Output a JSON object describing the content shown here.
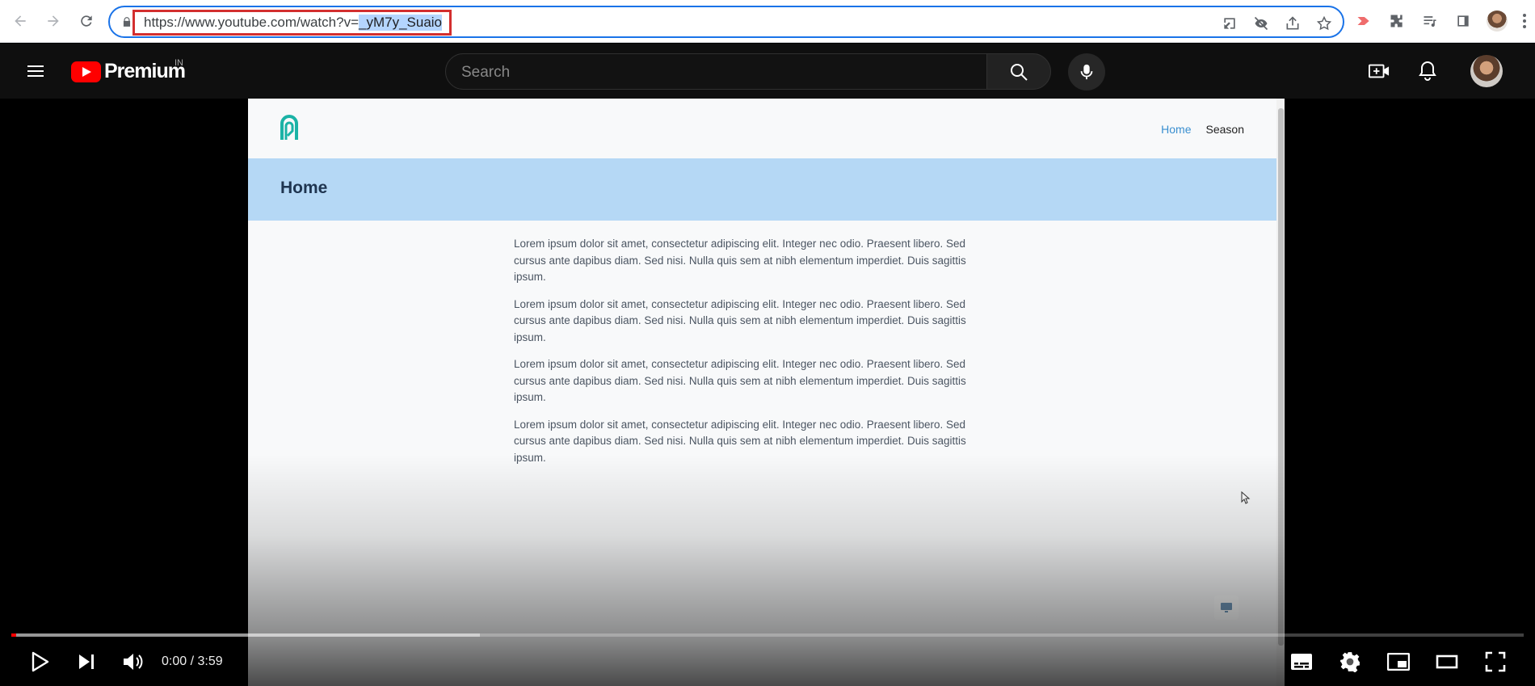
{
  "browser": {
    "url_prefix": "https://www.youtube.com/watch?v=",
    "url_selected": "_yM7y_Suaio",
    "icons": [
      "back-icon",
      "forward-icon",
      "reload-icon",
      "lock-icon",
      "install-icon",
      "eye-off-icon",
      "share-icon",
      "star-icon",
      "extension-icon",
      "puzzle-icon",
      "media-icon",
      "sidepanel-icon",
      "profile-avatar",
      "menu-icon"
    ]
  },
  "youtube": {
    "logo_text": "Premium",
    "country_code": "IN",
    "search_placeholder": "Search"
  },
  "video": {
    "site": {
      "nav_links": [
        "Home",
        "Season"
      ],
      "page_heading": "Home",
      "paragraphs": [
        "Lorem ipsum dolor sit amet, consectetur adipiscing elit. Integer nec odio. Praesent libero. Sed cursus ante dapibus diam. Sed nisi. Nulla quis sem at nibh elementum imperdiet. Duis sagittis ipsum.",
        "Lorem ipsum dolor sit amet, consectetur adipiscing elit. Integer nec odio. Praesent libero. Sed cursus ante dapibus diam. Sed nisi. Nulla quis sem at nibh elementum imperdiet. Duis sagittis ipsum.",
        "Lorem ipsum dolor sit amet, consectetur adipiscing elit. Integer nec odio. Praesent libero. Sed cursus ante dapibus diam. Sed nisi. Nulla quis sem at nibh elementum imperdiet. Duis sagittis ipsum.",
        "Lorem ipsum dolor sit amet, consectetur adipiscing elit. Integer nec odio. Praesent libero. Sed cursus ante dapibus diam. Sed nisi. Nulla quis sem at nibh elementum imperdiet. Duis sagittis ipsum."
      ]
    },
    "player": {
      "current_time": "0:00",
      "duration": "3:59",
      "time_display": "0:00 / 3:59",
      "buffered_fraction": 0.31,
      "played_fraction": 0.0
    }
  },
  "colors": {
    "accent": "#1a73e8",
    "highlight_box": "#d32f2f",
    "yt_red": "#ff0000",
    "home_band": "#b5d8f5"
  }
}
